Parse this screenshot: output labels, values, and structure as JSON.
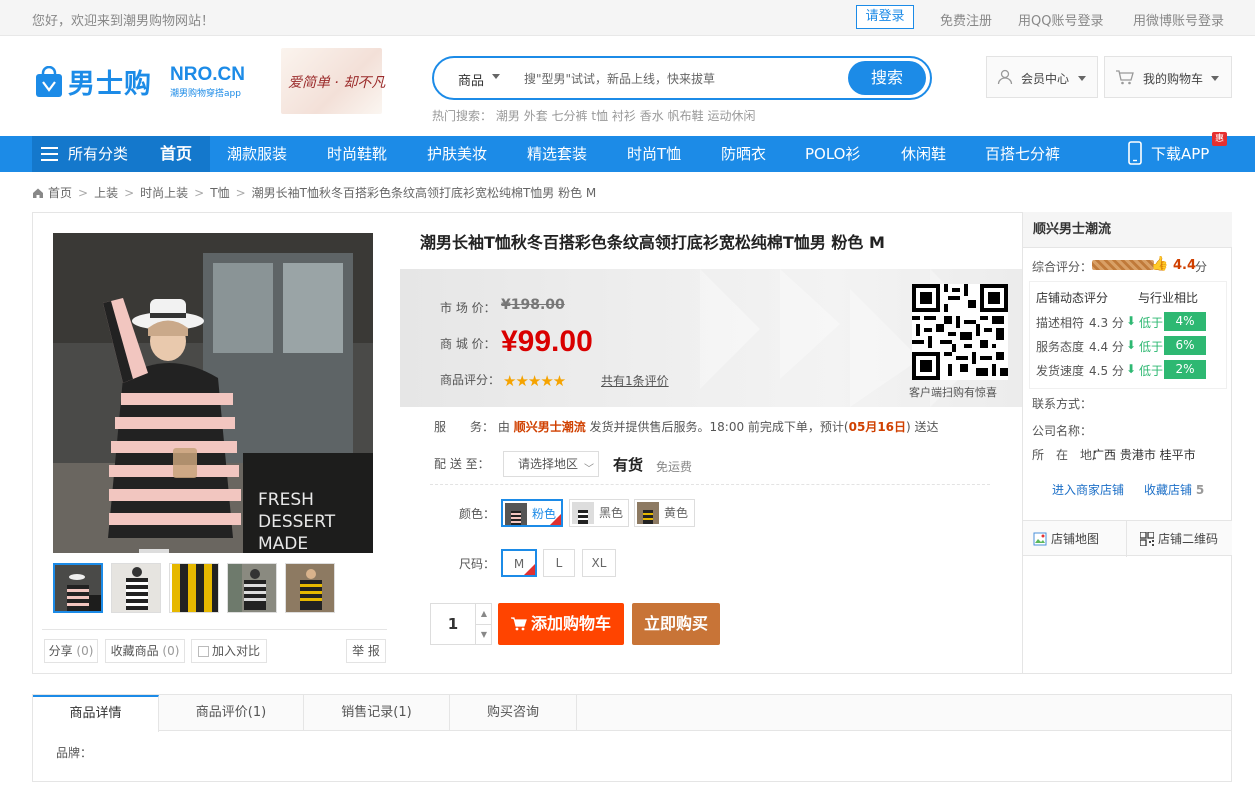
{
  "topbar": {
    "welcome": "您好，欢迎来到潮男购物网站！",
    "login": "请登录",
    "register": "免费注册",
    "qq_login": "用QQ账号登录",
    "weibo_login": "用微博账号登录"
  },
  "header": {
    "logo_main": "男士购",
    "logo_domain": "NRO.CN",
    "logo_sub": "潮男购物穿搭app",
    "banner_text": "爱简单 · 却不凡",
    "search": {
      "category": "商品",
      "placeholder": "搜\"型男\"试试，新品上线，快来拔草",
      "button": "搜索"
    },
    "hot_label": "热门搜索：",
    "hot_keywords": [
      "潮男",
      "外套",
      "七分裤",
      "t恤",
      "衬衫",
      "香水",
      "帆布鞋",
      "运动休闲"
    ],
    "member_center": "会员中心",
    "my_cart": "我的购物车"
  },
  "nav": {
    "all_categories": "所有分类",
    "home": "首页",
    "items": [
      "潮款服装",
      "时尚鞋靴",
      "护肤美妆",
      "精选套装",
      "时尚T恤",
      "防晒衣",
      "POLO衫",
      "休闲鞋",
      "百搭七分裤"
    ],
    "download_app": "下载APP",
    "hui_badge": "惠"
  },
  "breadcrumb": [
    "首页",
    "上装",
    "时尚上装",
    "T恤",
    "潮男长袖T恤秋冬百搭彩色条纹高领打底衫宽松纯棉T恤男 粉色 M"
  ],
  "product": {
    "title": "潮男长袖T恤秋冬百搭彩色条纹高领打底衫宽松纯棉T恤男 粉色 M",
    "market_price_label": "市 场 价：",
    "market_price": "¥198.00",
    "mall_price_label": "商 城 价：",
    "mall_price": "¥99.00",
    "rating_label": "商品评分：",
    "rating_stars": 5,
    "reviews_link": "共有1条评价",
    "qr_caption": "客户端扫购有惊喜",
    "service_label": "服　　务：",
    "service_prefix": "由",
    "service_shop": "顺兴男士潮流",
    "service_middle": "发货并提供售后服务。18:00 前完成下单，预计(",
    "service_date": "05月16日",
    "service_suffix": ") 送达",
    "delivery_label": "配 送 至：",
    "region_placeholder": "请选择地区",
    "stock": "有货",
    "shipping": "免运费",
    "color_label": "颜色：",
    "colors": [
      "粉色",
      "黑色",
      "黄色"
    ],
    "size_label": "尺码：",
    "sizes": [
      "M",
      "L",
      "XL"
    ],
    "quantity": "1",
    "add_to_cart": "添加购物车",
    "buy_now": "立即购买"
  },
  "gallery_actions": {
    "share": "分享",
    "share_count": "(0)",
    "favorite": "收藏商品",
    "favorite_count": "(0)",
    "compare": "加入对比",
    "report": "举 报"
  },
  "shop": {
    "name": "顺兴男士潮流",
    "overall_label": "综合评分：",
    "overall_score": "4.4",
    "overall_unit": "分",
    "dynamic_label": "店铺动态评分",
    "compare_label": "与行业相比",
    "metrics": [
      {
        "label": "描述相符",
        "score": "4.3 分",
        "trend": "低于",
        "pct": "4%"
      },
      {
        "label": "服务态度",
        "score": "4.4 分",
        "trend": "低于",
        "pct": "6%"
      },
      {
        "label": "发货速度",
        "score": "4.5 分",
        "trend": "低于",
        "pct": "2%"
      }
    ],
    "contact_label": "联系方式：",
    "company_label": "公司名称：",
    "location_label": "所　在　地：",
    "location": "广西 贵港市 桂平市",
    "enter_shop": "进入商家店铺",
    "fav_shop": "收藏店铺",
    "fav_count": "5",
    "map_button": "店铺地图",
    "qr_button": "店铺二维码"
  },
  "tabs": {
    "items": [
      "商品详情",
      "商品评价(1)",
      "销售记录(1)",
      "购买咨询"
    ],
    "brand_label": "品牌："
  },
  "colors": {
    "brand_blue": "#1c8be7",
    "price_red": "#d90000",
    "cart_orange": "#ff4400",
    "buy_brown": "#c87437",
    "trend_green": "#2eb872"
  }
}
